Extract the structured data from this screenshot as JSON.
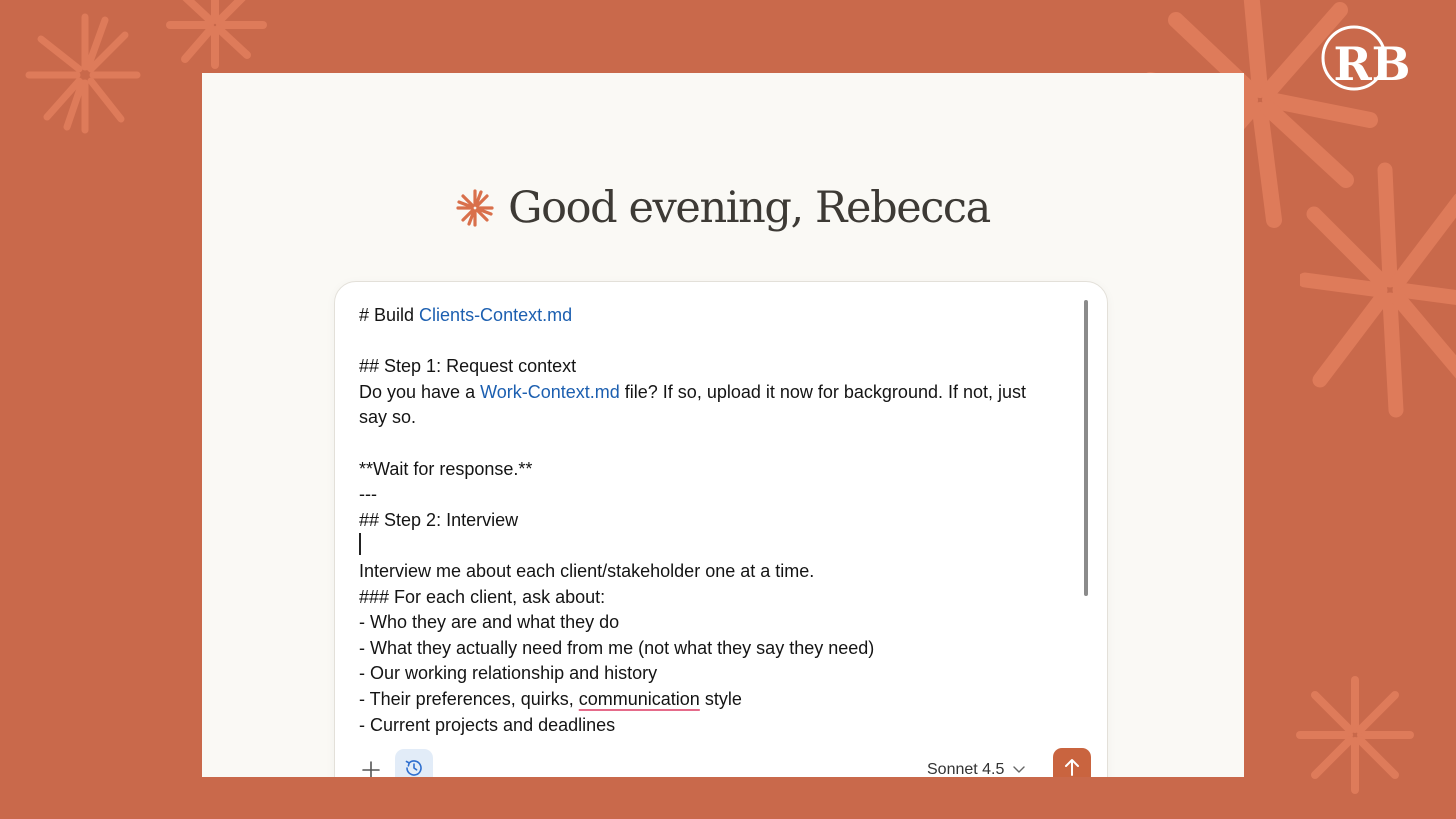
{
  "colors": {
    "background": "#c9694b",
    "panel": "#faf9f5",
    "accent": "#d9704b",
    "link": "#1c5fb0",
    "send_button": "#c9643f"
  },
  "brand": {
    "logo_letters": "RB",
    "logo_icon": "rb-monogram-icon",
    "greeting_icon": "starburst-icon"
  },
  "greeting": {
    "text": "Good evening, Rebecca"
  },
  "composer": {
    "lines": [
      [
        {
          "text": "# Build "
        },
        {
          "text": "Clients-Context.md",
          "style": "link"
        }
      ],
      [],
      [
        {
          "text": "## Step 1: Request context"
        }
      ],
      [
        {
          "text": "Do you have a "
        },
        {
          "text": "Work-Context.md",
          "style": "link"
        },
        {
          "text": " file? If so, upload it now for background. If not, just"
        }
      ],
      [
        {
          "text": "say so."
        }
      ],
      [],
      [
        {
          "text": "**Wait for response.**"
        }
      ],
      [
        {
          "text": "---"
        }
      ],
      [
        {
          "text": "## Step 2: Interview"
        }
      ],
      [
        {
          "caret": true
        }
      ],
      [
        {
          "text": "Interview me about each client/stakeholder one at a time."
        }
      ],
      [
        {
          "text": "### For each client, ask about:"
        }
      ],
      [
        {
          "text": "- Who they are and what they do"
        }
      ],
      [
        {
          "text": "- What they actually need from me (not what they say they need)"
        }
      ],
      [
        {
          "text": "- Our working relationship and history"
        }
      ],
      [
        {
          "text": "- Their preferences, quirks, "
        },
        {
          "text": "communication",
          "style": "squiggle"
        },
        {
          "text": " style"
        }
      ],
      [
        {
          "text": "- Current projects and deadlines"
        }
      ]
    ],
    "toolbar": {
      "add_icon": "plus-icon",
      "history_icon": "clock-history-icon",
      "model_label": "Sonnet 4.5",
      "model_chevron": "chevron-down-icon",
      "send_icon": "arrow-up-icon"
    }
  }
}
